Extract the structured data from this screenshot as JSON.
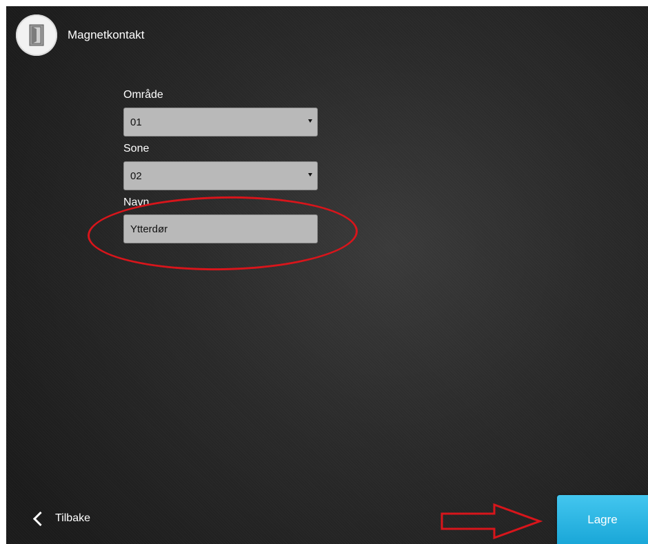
{
  "header": {
    "title": "Magnetkontakt",
    "icon": "door-sensor-icon"
  },
  "form": {
    "area_label": "Område",
    "area_value": "01",
    "zone_label": "Sone",
    "zone_value": "02",
    "name_label": "Navn",
    "name_value": "Ytterdør"
  },
  "footer": {
    "back_label": "Tilbake",
    "save_label": "Lagre"
  },
  "annotations": {
    "ellipse_color": "#d8151b",
    "arrow_color": "#d8151b"
  },
  "colors": {
    "accent": "#2bb6e3",
    "field_bg": "#b9b9b9"
  }
}
